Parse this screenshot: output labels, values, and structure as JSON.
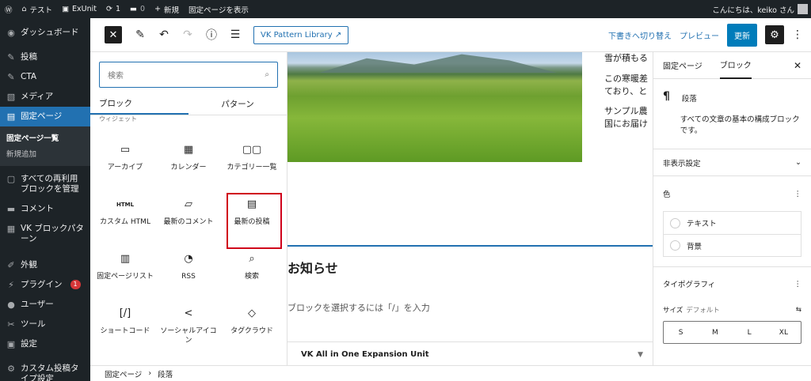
{
  "adminbar": {
    "site": "テスト",
    "exunit": "ExUnit",
    "updates": "1",
    "comments": "0",
    "new": "新規",
    "view_page": "固定ページを表示",
    "greeting": "こんにちは、keiko さん"
  },
  "sidebar": {
    "dashboard": "ダッシュボード",
    "posts": "投稿",
    "cta": "CTA",
    "media": "メディア",
    "pages": "固定ページ",
    "pages_all": "固定ページ一覧",
    "pages_new": "新規追加",
    "reusable": "すべての再利用ブロックを管理",
    "comments": "コメント",
    "vk_patterns": "VK ブロックパターン",
    "appearance": "外観",
    "plugins": "プラグイン",
    "plugins_badge": "1",
    "users": "ユーザー",
    "tools": "ツール",
    "settings": "設定",
    "custom_post": "カスタム投稿タイプ設定"
  },
  "header": {
    "pattern_library": "VK Pattern Library",
    "save_draft": "下書きへ切り替え",
    "preview": "プレビュー",
    "update": "更新"
  },
  "inserter": {
    "search_placeholder": "検索",
    "tab_blocks": "ブロック",
    "tab_patterns": "パターン",
    "category": "ウィジェット",
    "blocks": [
      {
        "label": "アーカイブ",
        "icon": "▭"
      },
      {
        "label": "カレンダー",
        "icon": "▦"
      },
      {
        "label": "カテゴリー一覧",
        "icon": "▢▢"
      },
      {
        "label": "カスタム HTML",
        "icon": "HTML"
      },
      {
        "label": "最新のコメント",
        "icon": "▱"
      },
      {
        "label": "最新の投稿",
        "icon": "▤"
      },
      {
        "label": "固定ページリスト",
        "icon": "▥"
      },
      {
        "label": "RSS",
        "icon": "◔"
      },
      {
        "label": "検索",
        "icon": "⌕"
      },
      {
        "label": "ショートコード",
        "icon": "[/]"
      },
      {
        "label": "ソーシャルアイコン",
        "icon": "<"
      },
      {
        "label": "タグクラウド",
        "icon": "◇"
      }
    ]
  },
  "canvas": {
    "para1": "雪が積もる",
    "para2a": "この寒暖差",
    "para2b": "ており、と",
    "para3a": "サンプル農",
    "para3b": "国にお届け",
    "heading": "お知らせ",
    "placeholder": "ブロックを選択するには「/」を入力",
    "vk_panel": "VK All in One Expansion Unit"
  },
  "settings": {
    "tab_page": "固定ページ",
    "tab_block": "ブロック",
    "block_title": "段落",
    "block_desc": "すべての文章の基本の構成ブロックです。",
    "hide_settings": "非表示設定",
    "color": "色",
    "color_text": "テキスト",
    "color_bg": "背景",
    "typography": "タイポグラフィ",
    "size_label": "サイズ",
    "size_default": "デフォルト",
    "sizes": [
      "S",
      "M",
      "L",
      "XL"
    ]
  },
  "footer": {
    "crumb1": "固定ページ",
    "crumb2": "段落"
  },
  "colors": {
    "admin_bg": "#1d2327",
    "accent": "#2271b1",
    "highlight": "#d0021b"
  }
}
